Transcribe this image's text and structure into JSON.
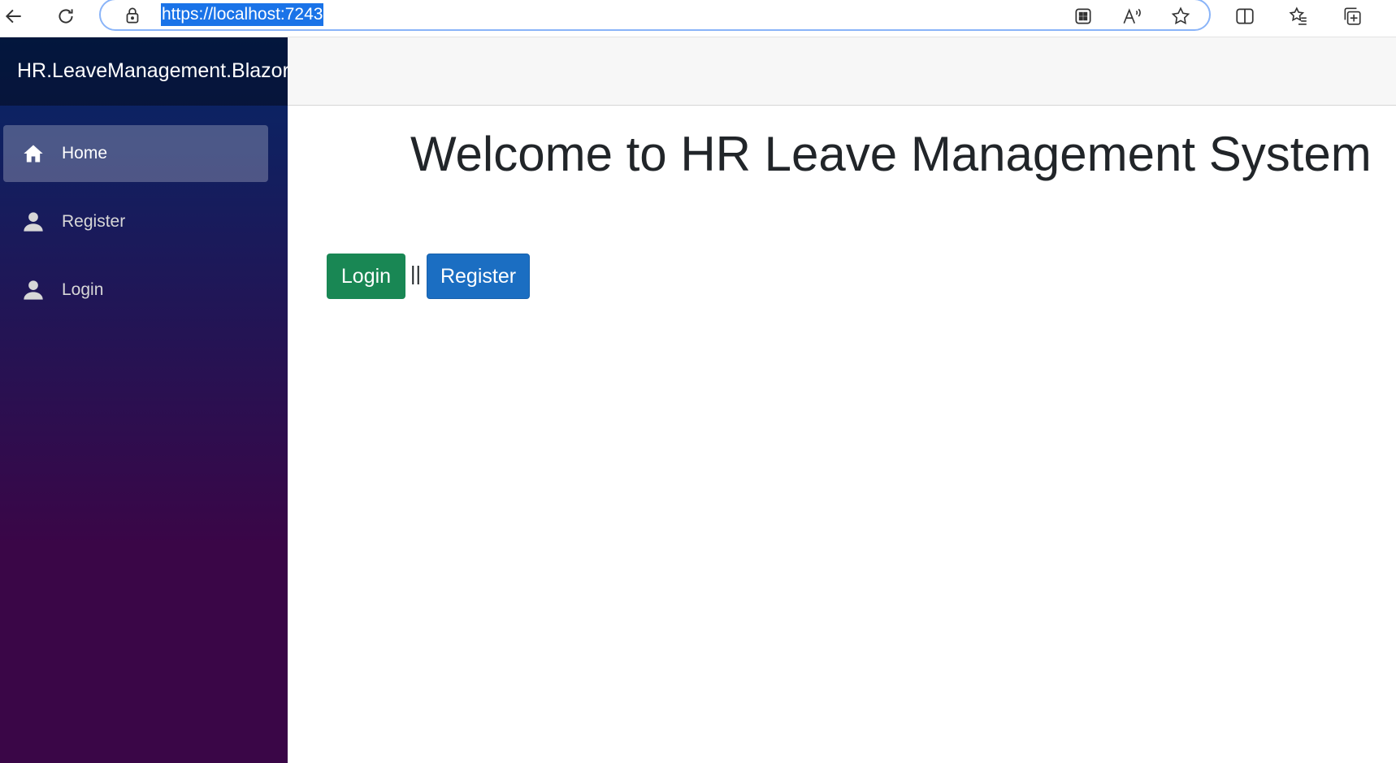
{
  "browser": {
    "url": "https://localhost:7243",
    "icons": [
      "back-arrow-icon",
      "refresh-icon",
      "lock-icon",
      "apps-icon",
      "read-aloud-icon",
      "favorite-star-icon",
      "split-screen-icon",
      "favorites-list-icon",
      "collections-icon"
    ]
  },
  "sidebar": {
    "brand": "HR.LeaveManagement.Blazor",
    "items": [
      {
        "label": "Home",
        "icon": "home-icon",
        "active": true
      },
      {
        "label": "Register",
        "icon": "person-icon",
        "active": false
      },
      {
        "label": "Login",
        "icon": "person-icon",
        "active": false
      }
    ]
  },
  "main": {
    "title": "Welcome to HR Leave Management System",
    "login_label": "Login",
    "separator": "||",
    "register_label": "Register"
  },
  "colors": {
    "login_button": "#198754",
    "register_button": "#1b6ec2",
    "sidebar_top": "#052767",
    "sidebar_bottom": "#3a0647"
  }
}
